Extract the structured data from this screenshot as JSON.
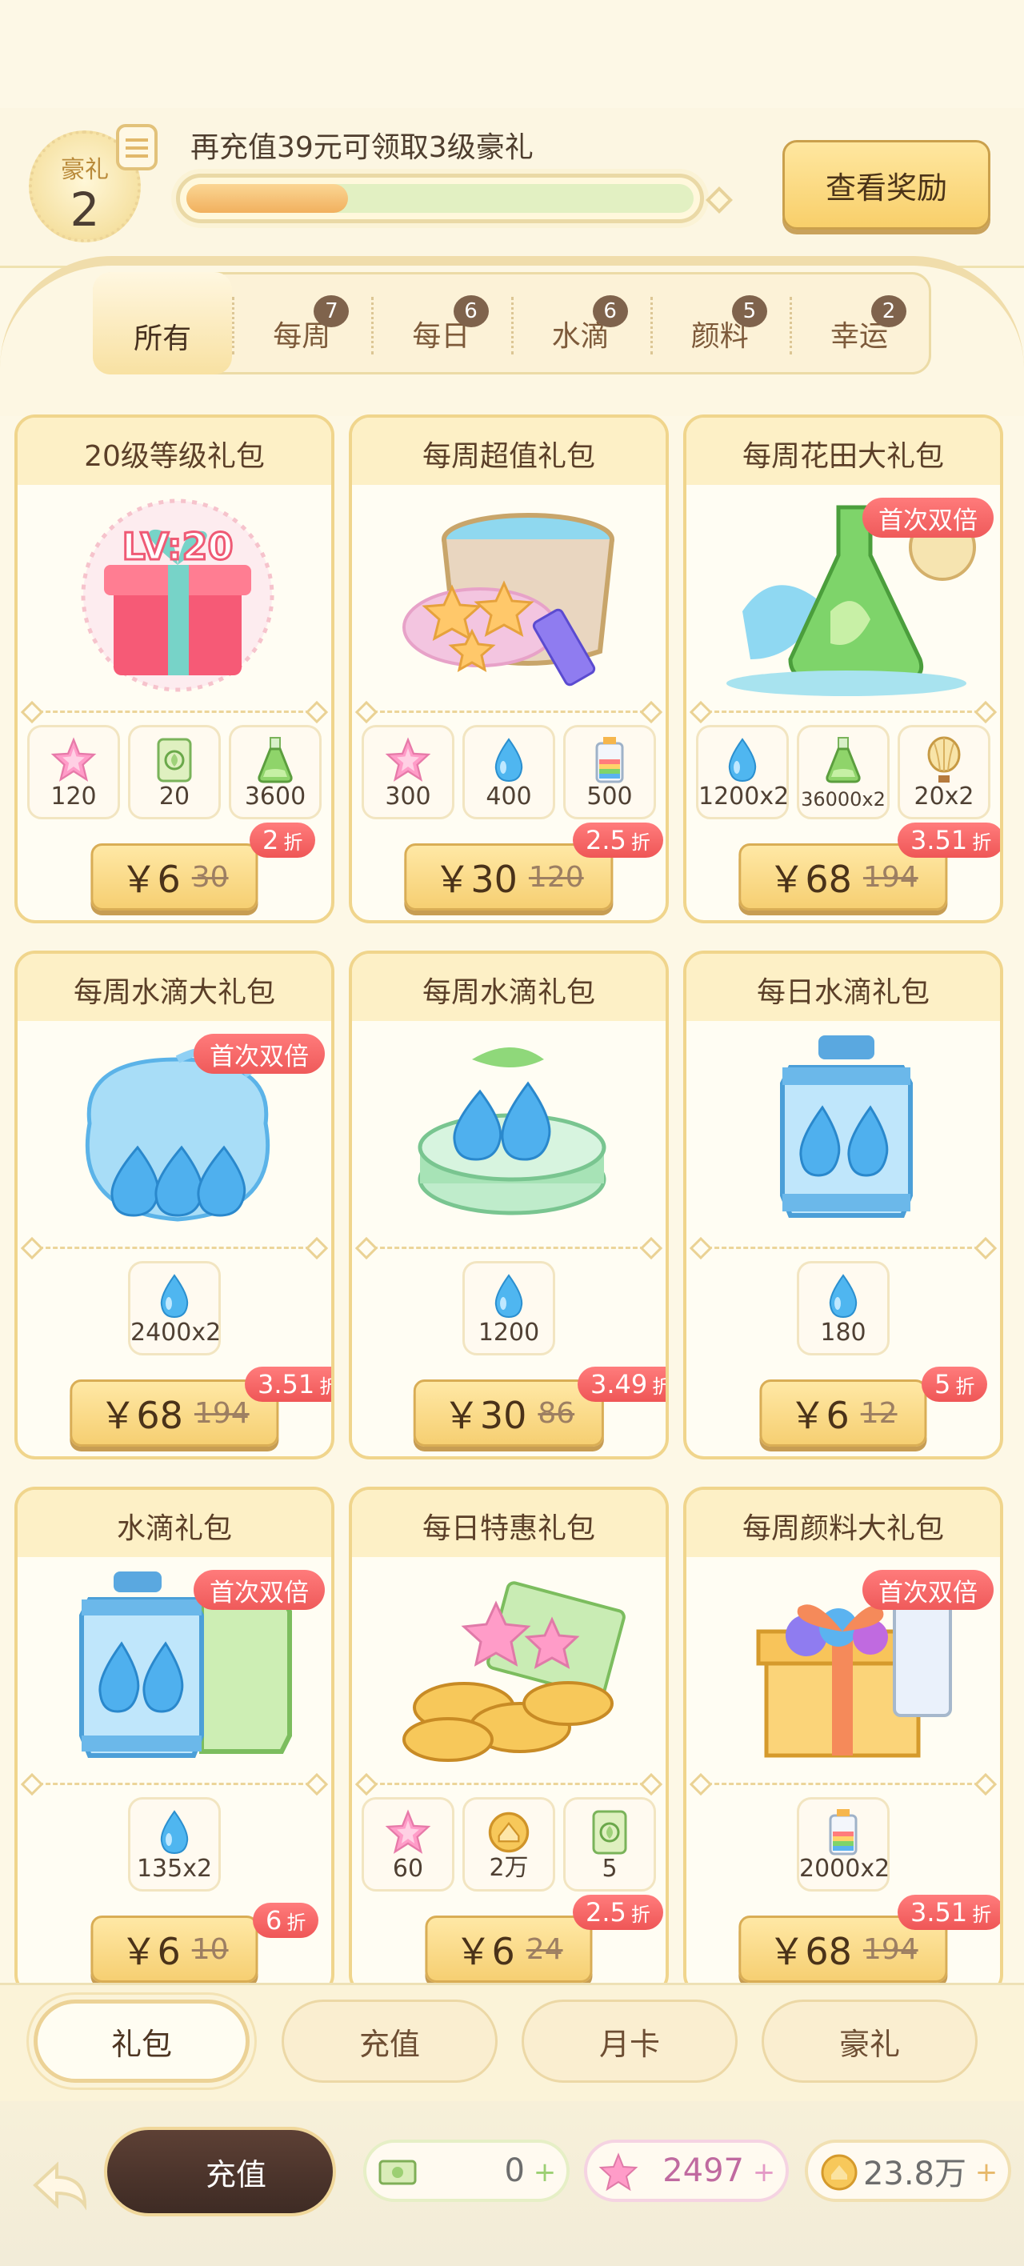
{
  "vip": {
    "badge_label": "豪礼",
    "level": "2",
    "message": "再充值39元可领取3级豪礼",
    "progress": 0.32,
    "view_button": "查看奖励"
  },
  "tabs": [
    {
      "label": "所有",
      "count": null
    },
    {
      "label": "每周",
      "count": "7"
    },
    {
      "label": "每日",
      "count": "6"
    },
    {
      "label": "水滴",
      "count": "6"
    },
    {
      "label": "颜料",
      "count": "5"
    },
    {
      "label": "幸运",
      "count": "2"
    }
  ],
  "packs": [
    {
      "title": "20级等级礼包",
      "art": "level-20-gift",
      "promo": null,
      "rewards": [
        {
          "icon": "star-icon",
          "qty": "120"
        },
        {
          "icon": "card-icon",
          "qty": "20"
        },
        {
          "icon": "potion-icon",
          "qty": "3600"
        }
      ],
      "price": "￥6",
      "original": "30",
      "discount": "2",
      "discount_unit": "折"
    },
    {
      "title": "每周超值礼包",
      "art": "star-paint-bucket",
      "promo": null,
      "rewards": [
        {
          "icon": "star-icon",
          "qty": "300"
        },
        {
          "icon": "water-drop-icon",
          "qty": "400"
        },
        {
          "icon": "paint-tube-icon",
          "qty": "500"
        }
      ],
      "price": "￥30",
      "original": "120",
      "discount": "2.5",
      "discount_unit": "折"
    },
    {
      "title": "每周花田大礼包",
      "art": "green-flask",
      "promo": "首次双倍",
      "rewards": [
        {
          "icon": "water-drop-icon",
          "qty": "1200x2"
        },
        {
          "icon": "potion-icon",
          "qty": "36000x2"
        },
        {
          "icon": "hot-air-balloon-icon",
          "qty": "20x2"
        }
      ],
      "price": "￥68",
      "original": "194",
      "discount": "3.51",
      "discount_unit": "折"
    },
    {
      "title": "每周水滴大礼包",
      "art": "water-drop-bag",
      "promo": "首次双倍",
      "rewards": [
        {
          "icon": "water-drop-icon",
          "qty": "2400x2"
        }
      ],
      "price": "￥68",
      "original": "194",
      "discount": "3.51",
      "discount_unit": "折"
    },
    {
      "title": "每周水滴礼包",
      "art": "water-drop-box",
      "promo": null,
      "rewards": [
        {
          "icon": "water-drop-icon",
          "qty": "1200"
        }
      ],
      "price": "￥30",
      "original": "86",
      "discount": "3.49",
      "discount_unit": "折"
    },
    {
      "title": "每日水滴礼包",
      "art": "water-drop-lantern",
      "promo": null,
      "rewards": [
        {
          "icon": "water-drop-icon",
          "qty": "180"
        }
      ],
      "price": "￥6",
      "original": "12",
      "discount": "5",
      "discount_unit": "折"
    },
    {
      "title": "水滴礼包",
      "art": "water-drop-lanterns",
      "promo": "首次双倍",
      "rewards": [
        {
          "icon": "water-drop-icon",
          "qty": "135x2"
        }
      ],
      "price": "￥6",
      "original": "10",
      "discount": "6",
      "discount_unit": "折"
    },
    {
      "title": "每日特惠礼包",
      "art": "coin-pile",
      "promo": null,
      "rewards": [
        {
          "icon": "star-icon",
          "qty": "60"
        },
        {
          "icon": "coin-icon",
          "qty": "2万"
        },
        {
          "icon": "card-icon",
          "qty": "5"
        }
      ],
      "price": "￥6",
      "original": "24",
      "discount": "2.5",
      "discount_unit": "折"
    },
    {
      "title": "每周颜料大礼包",
      "art": "paint-gift-box",
      "promo": "首次双倍",
      "rewards": [
        {
          "icon": "paint-tube-icon",
          "qty": "2000x2"
        }
      ],
      "price": "￥68",
      "original": "194",
      "discount": "3.51",
      "discount_unit": "折"
    }
  ],
  "bottom_nav": [
    "礼包",
    "充值",
    "月卡",
    "豪礼"
  ],
  "footer": {
    "recharge_label": "充值",
    "resources": [
      {
        "icon": "cash-icon",
        "value": "0"
      },
      {
        "icon": "star-icon",
        "value": "2497"
      },
      {
        "icon": "coin-icon",
        "value": "23.8万"
      }
    ]
  },
  "colors": {
    "background": "#fdf8e6",
    "card_border": "#f0d58c",
    "price_button": "#f8d57a",
    "discount_badge": "#f25c5c",
    "recharge_button": "#4a332b"
  }
}
